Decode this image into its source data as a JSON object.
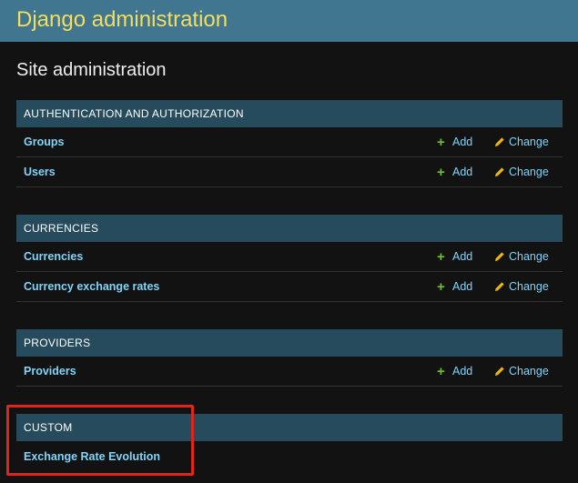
{
  "header": {
    "branding": "Django administration"
  },
  "page": {
    "title": "Site administration"
  },
  "actions": {
    "add_label": "Add",
    "change_label": "Change"
  },
  "colors": {
    "header_bg": "#417690",
    "branding": "#f5dd5d",
    "caption_bg": "#264b5d",
    "link": "#81d4fa",
    "add_icon": "#70bf2b",
    "change_icon": "#efb80b",
    "highlight": "#e0261b"
  },
  "modules": [
    {
      "caption": "AUTHENTICATION AND AUTHORIZATION",
      "models": [
        {
          "name": "Groups"
        },
        {
          "name": "Users"
        }
      ]
    },
    {
      "caption": "CURRENCIES",
      "models": [
        {
          "name": "Currencies"
        },
        {
          "name": "Currency exchange rates"
        }
      ]
    },
    {
      "caption": "PROVIDERS",
      "models": [
        {
          "name": "Providers"
        }
      ]
    },
    {
      "caption": "CUSTOM",
      "models": [
        {
          "name": "Exchange Rate Evolution"
        }
      ]
    }
  ],
  "icons": {
    "add": "plus-icon",
    "change": "pencil-icon"
  }
}
